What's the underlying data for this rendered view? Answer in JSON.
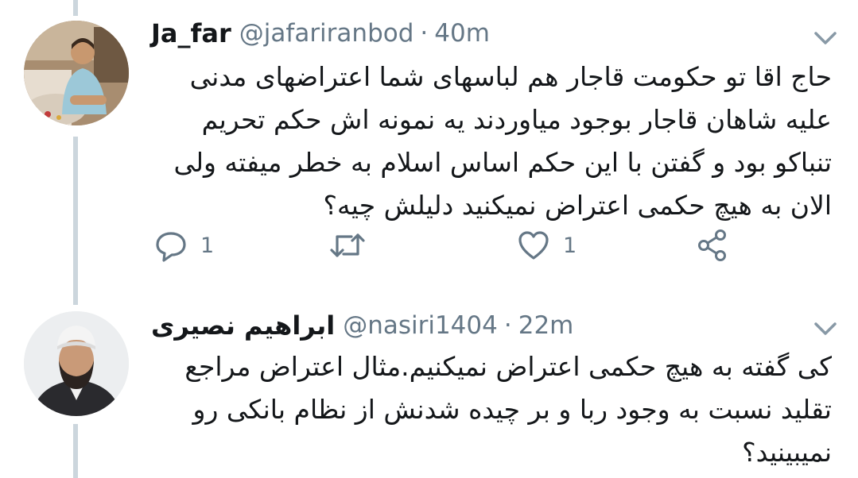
{
  "tweets": [
    {
      "author_name": "Ja_far",
      "handle": "@jafariranbod",
      "separator": "·",
      "time": "40m",
      "text": "حاج اقا تو حکومت قاجار هم لباسهای شما اعتراضهای مدنی علیه شاهان قاجار بوجود میاوردند یه نمونه اش حکم تحریم تنباکو بود و گفتن با این حکم اساس اسلام به خطر میفته ولی الان به هیچ حکمی اعتراض نمیکنید دلیلش چیه؟",
      "reply_count": "1",
      "like_count": "1"
    },
    {
      "author_name": "ابراهیم نصیری",
      "handle": "@nasiri1404",
      "separator": "·",
      "time": "22m",
      "text": "کی گفته به هیچ حکمی اعتراض نمیکنیم.مثال اعتراض مراجع تقلید نسبت به وجود ربا و بر چیده شدنش از نظام بانکی رو نمیبینید؟"
    }
  ],
  "icons": {
    "caret": "chevron-down-icon",
    "reply": "reply-icon",
    "retweet": "retweet-icon",
    "like": "heart-icon",
    "share": "share-icon"
  },
  "colors": {
    "text": "#14171a",
    "secondary": "#657786",
    "thread_line": "#ccd6dd",
    "background": "#ffffff"
  }
}
